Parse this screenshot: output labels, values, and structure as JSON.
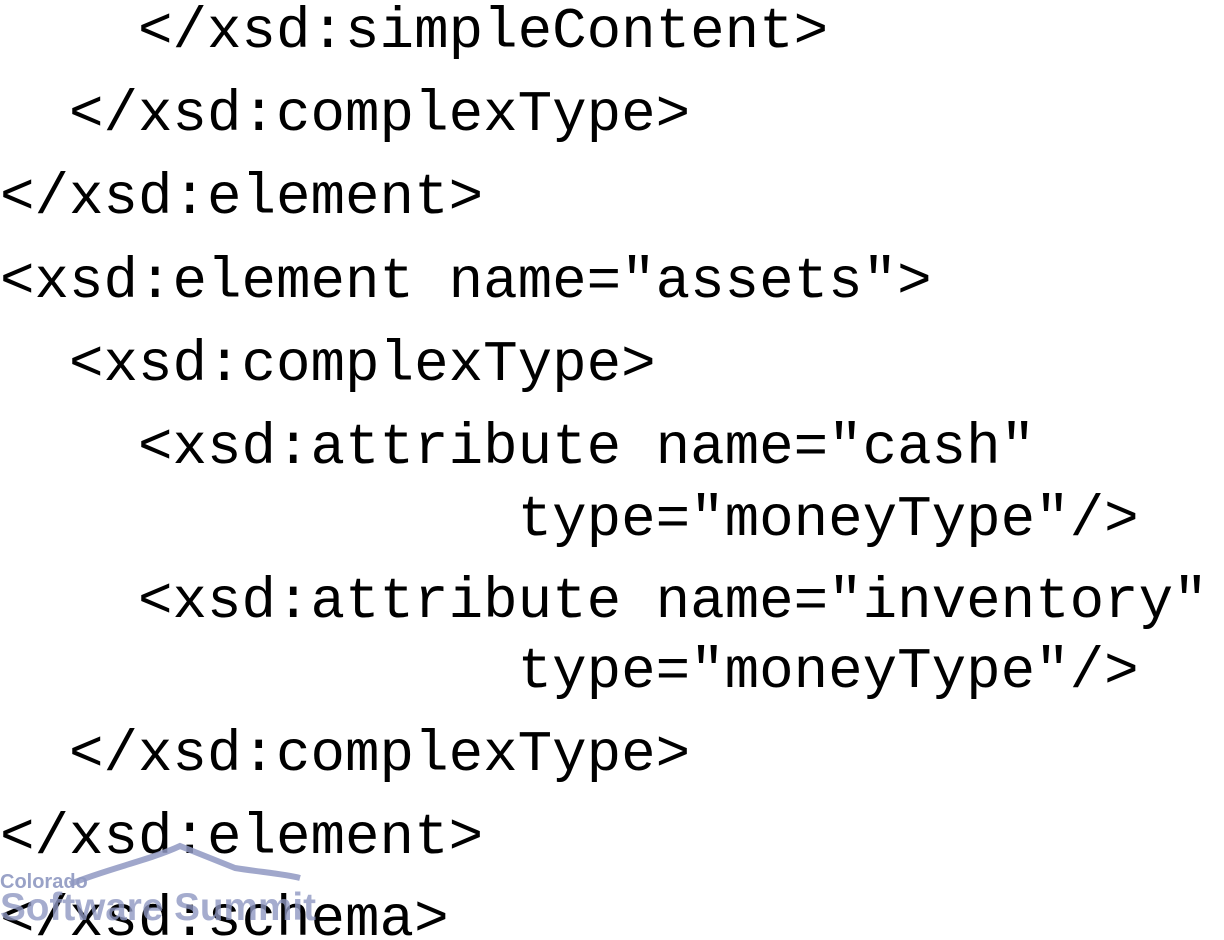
{
  "code_lines": [
    "    </xsd:simpleContent>",
    "  </xsd:complexType>",
    "</xsd:element>",
    "<xsd:element name=\"assets\">",
    "  <xsd:complexType>",
    "    <xsd:attribute name=\"cash\"",
    "               type=\"moneyType\"/>",
    "    <xsd:attribute name=\"inventory\"",
    "               type=\"moneyType\"/>",
    "  </xsd:complexType>",
    "</xsd:element>",
    "</xsd:schema>"
  ],
  "logo": {
    "line1": "Colorado",
    "line2": "Software Summit",
    "color": "#8f98c2"
  }
}
